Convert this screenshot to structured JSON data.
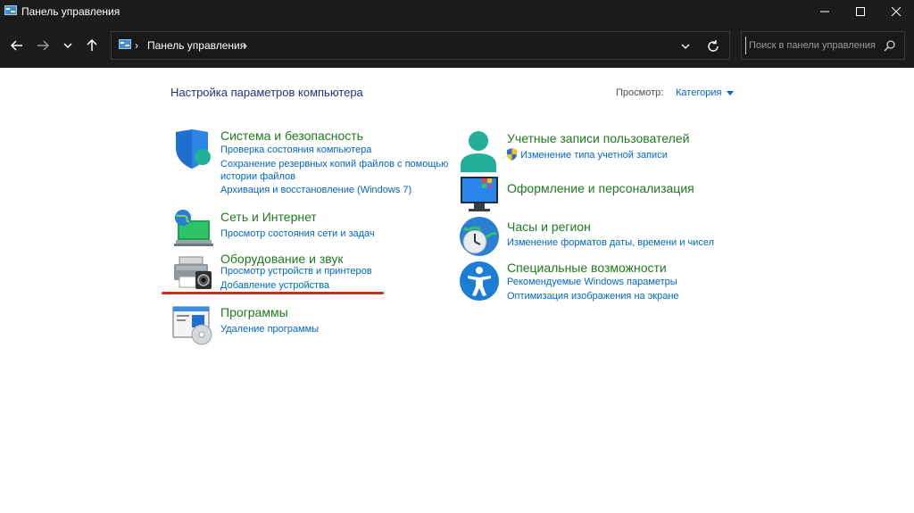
{
  "window": {
    "title": "Панель управления"
  },
  "address": {
    "breadcrumb": "Панель управления",
    "search_placeholder": "Поиск в панели управления"
  },
  "main": {
    "heading": "Настройка параметров компьютера",
    "view_by_label": "Просмотр:",
    "view_by_value": "Категория",
    "categories_left": [
      {
        "title": "Система и безопасность",
        "icon": "shield-icon",
        "links": [
          "Проверка состояния компьютера",
          "Сохранение резервных копий файлов с помощью",
          "истории файлов",
          "Архивация и восстановление (Windows 7)"
        ]
      },
      {
        "title": "Сеть и Интернет",
        "icon": "network-icon",
        "links": [
          "Просмотр состояния сети и задач"
        ]
      },
      {
        "title": "Оборудование и звук",
        "icon": "printer-icon",
        "links": [
          "Просмотр устройств и принтеров",
          "Добавление устройства"
        ]
      },
      {
        "title": "Программы",
        "icon": "programs-icon",
        "links": [
          "Удаление программы"
        ]
      }
    ],
    "categories_right": [
      {
        "title": "Учетные записи пользователей",
        "icon": "user-icon",
        "links": [
          "Изменение типа учетной записи"
        ]
      },
      {
        "title": "Оформление и персонализация",
        "icon": "monitor-icon",
        "links": []
      },
      {
        "title": "Часы и регион",
        "icon": "clock-globe-icon",
        "links": [
          "Изменение форматов даты, времени и чисел"
        ]
      },
      {
        "title": "Специальные возможности",
        "icon": "accessibility-icon",
        "links": [
          "Рекомендуемые Windows параметры",
          "Оптимизация изображения на экране"
        ]
      }
    ]
  },
  "colors": {
    "titlebar_bg": "#1c1c1c",
    "category_title": "#1d7a1d",
    "link": "#0066cc",
    "heading": "#1e3287",
    "annotation_underline": "#e32020"
  }
}
